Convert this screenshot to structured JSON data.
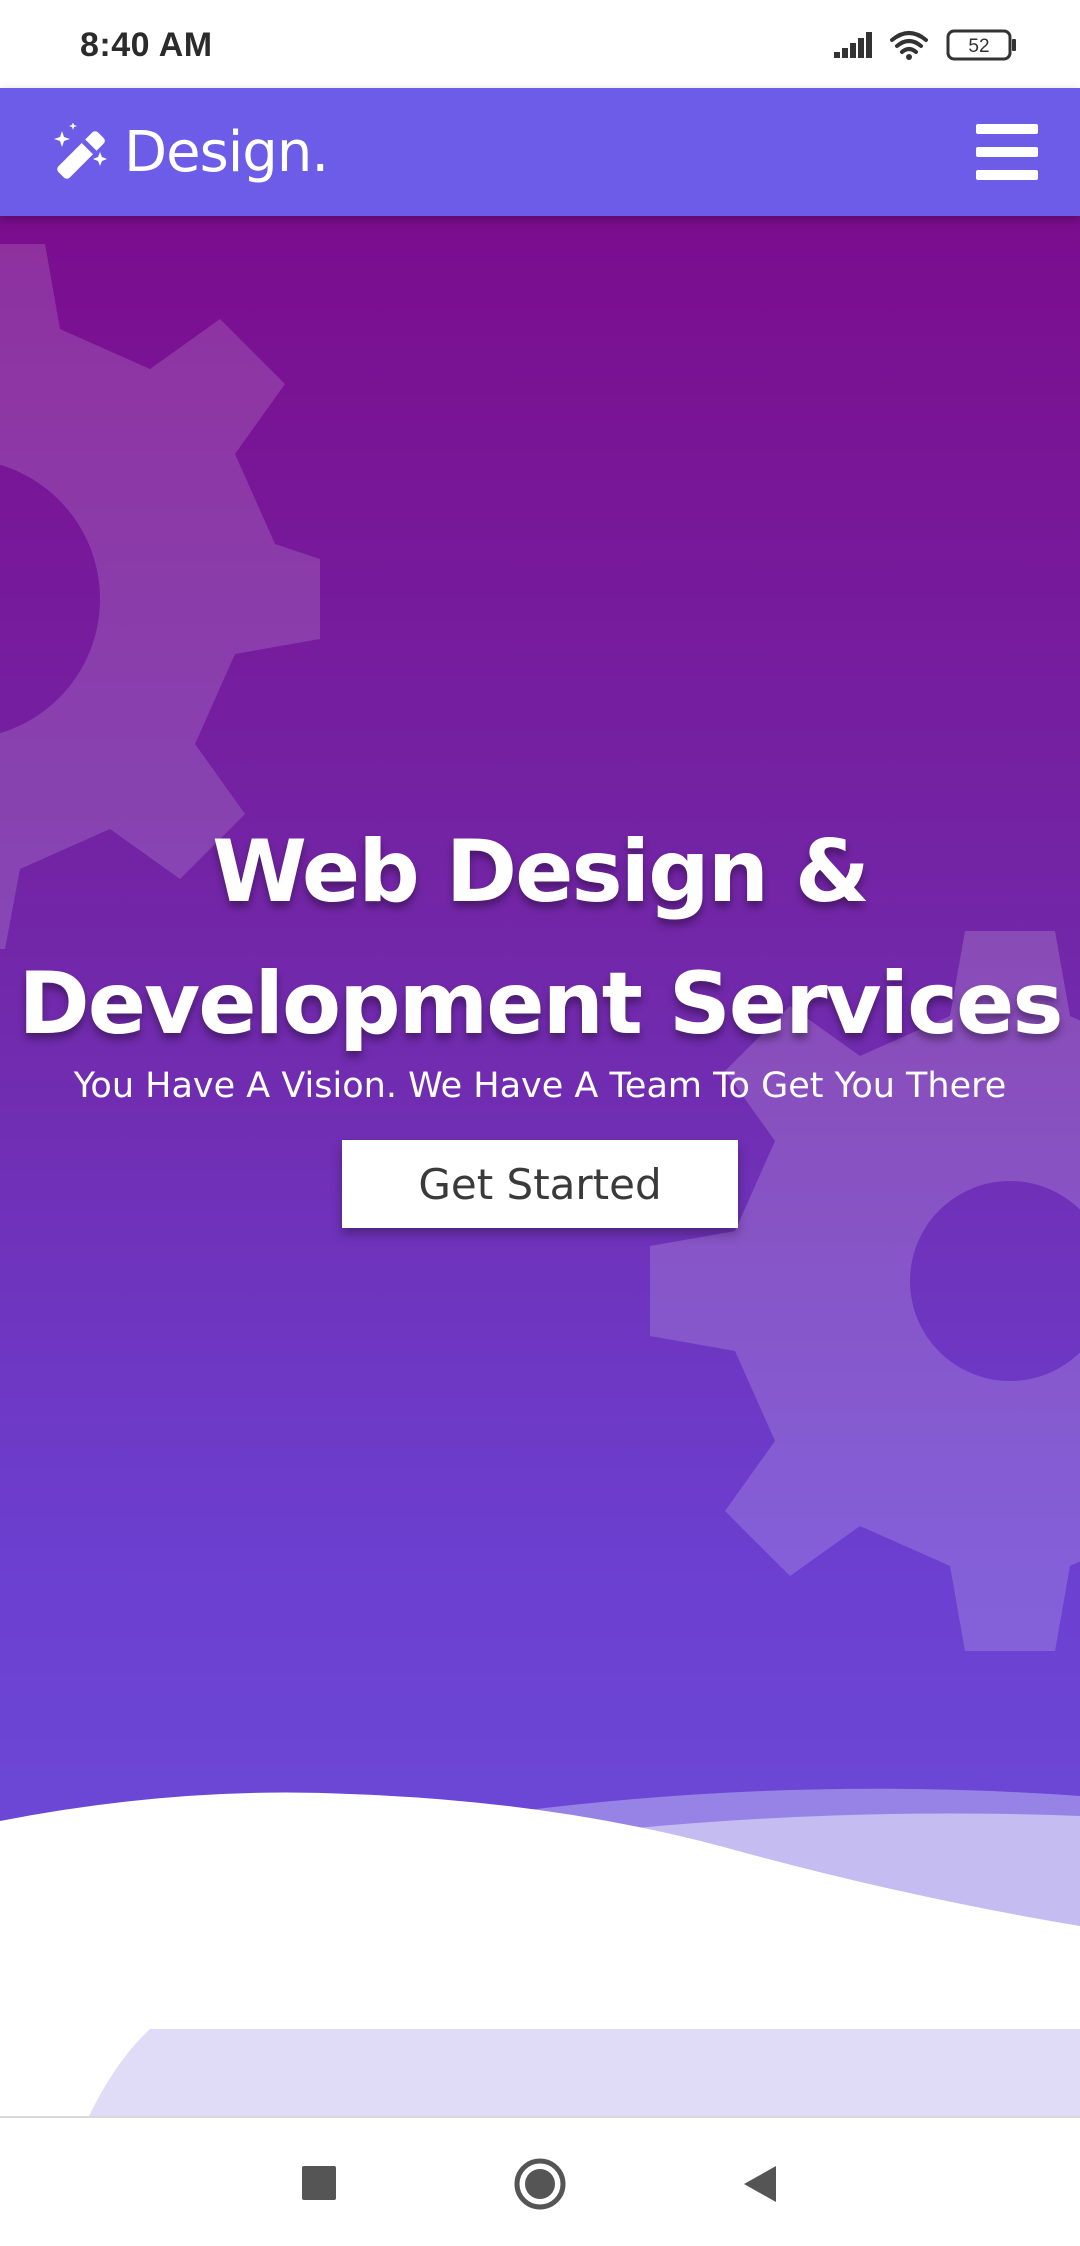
{
  "status_bar": {
    "time": "8:40 AM",
    "battery_level": "52",
    "icons": [
      "signal-icon",
      "wifi-icon",
      "battery-icon"
    ]
  },
  "header": {
    "logo_text": "Design.",
    "logo_icon": "magic-wand-icon",
    "menu_icon": "hamburger-menu-icon"
  },
  "hero": {
    "title_line1": "Web Design &",
    "title_line2": "Development Services",
    "subtitle": "You Have A Vision. We Have A Team To Get You There",
    "cta_label": "Get Started"
  },
  "nav_bar": {
    "buttons": [
      "recents-square-icon",
      "home-circle-icon",
      "back-triangle-icon"
    ]
  },
  "colors": {
    "header_bg": "#6c5ce7",
    "hero_top": "#7b0d8e",
    "hero_bottom": "#6b51dd",
    "wave_accent": "#c5bcf2",
    "text_light": "#ffffff"
  }
}
